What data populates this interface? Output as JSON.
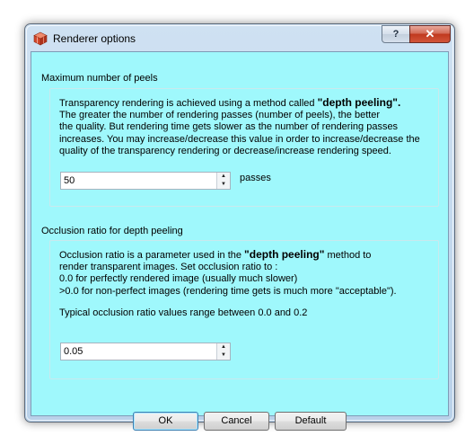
{
  "window": {
    "title": "Renderer options",
    "help_label": "?",
    "close_label": "✕"
  },
  "peels": {
    "group_title": "Maximum number of peels",
    "description_pre": "Transparency rendering is achieved using a method called ",
    "description_emph": "\"depth peeling\".",
    "description_lines": [
      "The greater the number of rendering passes (number of peels), the better",
      "the quality. But rendering time gets slower as the number of rendering passes",
      "increases. You may increase/decrease this value in order to increase/decrease the",
      "quality of the transparency rendering or decrease/increase rendering speed."
    ],
    "value": "50",
    "suffix": "passes"
  },
  "occlusion": {
    "group_title": "Occlusion ratio for depth peeling",
    "line1_pre": "Occlusion ratio is a parameter used in the ",
    "line1_emph": "\"depth peeling\"",
    "line1_post": " method to",
    "lines": [
      "render transparent images. Set occlusion ratio to :",
      "0.0 for perfectly rendered image (usually much slower)",
      ">0.0 for non-perfect images (rendering time gets is much more \"acceptable\")."
    ],
    "typical": "Typical occlusion ratio values range between 0.0 and 0.2",
    "value": "0.05"
  },
  "buttons": {
    "ok": "OK",
    "cancel": "Cancel",
    "default": "Default"
  },
  "icons": {
    "app": "cube-app-icon",
    "spin_up": "▲",
    "spin_down": "▼"
  },
  "colors": {
    "client_background": "#9ff8fc",
    "close_red": "#c0391f"
  }
}
